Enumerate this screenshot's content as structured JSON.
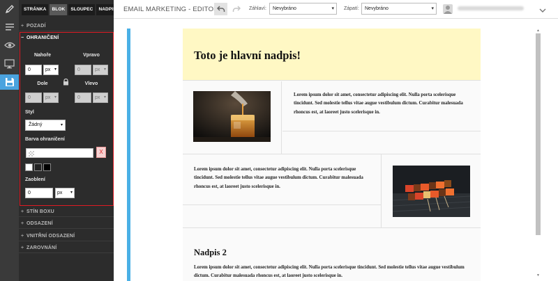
{
  "app": {
    "title": "EMAIL MARKETING - EDITOR"
  },
  "panel": {
    "tabs": [
      {
        "label": "STRÁNKA"
      },
      {
        "label": "BLOK"
      },
      {
        "label": "SLOUPEC"
      },
      {
        "label": "NADPIS"
      }
    ],
    "sections": {
      "pozadi": "POZADÍ",
      "ohraniceni": "OHRANIČENÍ",
      "stin": "STÍN BOXU",
      "odsazeni": "ODSAZENÍ",
      "vnitrni": "VNITŘNÍ ODSAZENÍ",
      "zarovnani": "ZAROVNÁNÍ"
    },
    "symbols": {
      "collapsed": "+",
      "expanded": "−"
    },
    "border": {
      "top_label": "Nahoře",
      "right_label": "Vpravo",
      "bottom_label": "Dole",
      "left_label": "Vlevo",
      "top_value": "0",
      "right_value": "0",
      "bottom_value": "0",
      "left_value": "0",
      "unit": "px",
      "style_label": "Styl",
      "style_value": "Žádný",
      "color_label": "Barva ohraničení",
      "clear_label": "X",
      "radius_label": "Zaoblení",
      "radius_value": "0",
      "radius_unit": "px",
      "presets": [
        "#ffffff",
        "#222222",
        "#000000"
      ]
    }
  },
  "topbar": {
    "header_label": "Záhlaví:",
    "header_value": "Nevybráno",
    "footer_label": "Zápatí:",
    "footer_value": "Nevybráno"
  },
  "email": {
    "heading": "Toto je hlavní nadpis!",
    "lorem": "Lorem ipsum dolor sit amet, consectetur adipiscing elit. Nulla porta scelerisque tincidunt. Sed molestie tellus vitae augue vestibulum dictum. Curabitur malesuada rhoncus est, at laoreet justo scelerisque in.",
    "lorem_right": "Lorem ipsum dolor sit amet, consectetur adipiscing elit. Nulla porta scelerisque tincidunt. Sed molestie tellus vitae augue vestibulum dictum. Curabitur malesuada rhoncus est, at laoreet justo scelerisque in.",
    "heading2": "Nadpis 2",
    "lorem_wide": "Lorem ipsum dolor sit amet, consectetur adipiscing elit. Nulla porta scelerisque tincidunt. Sed molestie tellus vitae augue vestibulum dictum. Curabitur malesuada rhoncus est, at laoreet justo scelerisque in."
  },
  "colors": {
    "accent": "#4ab0e6",
    "selection": "#e01b24",
    "header_bg": "#fff8c4"
  }
}
